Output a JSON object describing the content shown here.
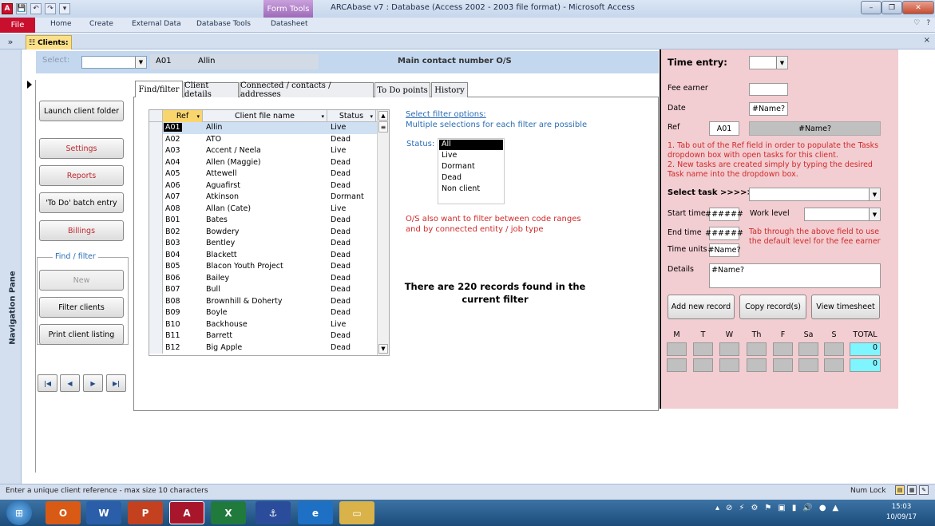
{
  "window": {
    "title": "ARCAbase v7 : Database (Access 2002 - 2003 file format)  -  Microsoft Access",
    "contextual_tab": "Form Tools",
    "file_tab": "File",
    "ribbon_tabs": [
      "Home",
      "Create",
      "External Data",
      "Database Tools",
      "Datasheet"
    ],
    "min_glyph": "–",
    "max_glyph": "❐",
    "close_glyph": "✕"
  },
  "document": {
    "tab_label": "Clients:",
    "navigation_pane_label": "Navigation Pane",
    "nav_collapse_glyph": "»",
    "close_glyph": "×"
  },
  "header": {
    "select_label": "Select:",
    "select_value": "",
    "ref": "A01",
    "name": "Allin",
    "main_contact": "Main contact number O/S"
  },
  "left_buttons": {
    "launch_client_folder": "Launch client folder",
    "settings": "Settings",
    "reports": "Reports",
    "todo_batch_entry": "'To Do' batch entry",
    "billings": "Billings",
    "find_filter_frame": "Find / filter",
    "new": "New",
    "filter_clients": "Filter clients",
    "print_client_listing": "Print client listing"
  },
  "record_nav": {
    "first": "|◀",
    "prev": "◀",
    "next": "▶",
    "last": "▶|"
  },
  "tabs": [
    "Find/filter",
    "Client details",
    "Connected / contacts / addresses",
    "To Do points",
    "History"
  ],
  "grid": {
    "columns": [
      "Ref",
      "Client file name",
      "Status"
    ],
    "rows": [
      [
        "A01",
        "Allin",
        "Live"
      ],
      [
        "A02",
        "ATO",
        "Dead"
      ],
      [
        "A03",
        "Accent / Neela",
        "Live"
      ],
      [
        "A04",
        "Allen (Maggie)",
        "Dead"
      ],
      [
        "A05",
        "Attewell",
        "Dead"
      ],
      [
        "A06",
        "Aguafirst",
        "Dead"
      ],
      [
        "A07",
        "Atkinson",
        "Dormant"
      ],
      [
        "A08",
        "Allan (Cate)",
        "Live"
      ],
      [
        "B01",
        "Bates",
        "Dead"
      ],
      [
        "B02",
        "Bowdery",
        "Dead"
      ],
      [
        "B03",
        "Bentley",
        "Dead"
      ],
      [
        "B04",
        "Blackett",
        "Dead"
      ],
      [
        "B05",
        "Blacon Youth Project",
        "Dead"
      ],
      [
        "B06",
        "Bailey",
        "Dead"
      ],
      [
        "B07",
        "Bull",
        "Dead"
      ],
      [
        "B08",
        "Brownhill & Doherty",
        "Dead"
      ],
      [
        "B09",
        "Boyle",
        "Dead"
      ],
      [
        "B10",
        "Backhouse",
        "Live"
      ],
      [
        "B11",
        "Barrett",
        "Dead"
      ],
      [
        "B12",
        "Big Apple",
        "Dead"
      ]
    ]
  },
  "filter": {
    "options_link": "Select filter options:",
    "options_sub": "Multiple selections for each filter are possible",
    "status_label": "Status:",
    "status_options": [
      "All",
      "Live",
      "Dormant",
      "Dead",
      "Non client"
    ],
    "note_line1": "O/S also want to filter between code ranges",
    "note_line2": "and by connected entity / job type",
    "records_found": "There are 220 records found in the current filter"
  },
  "time_entry": {
    "title": "Time entry:",
    "fee_earner_label": "Fee earner",
    "fee_earner_value": "",
    "date_label": "Date",
    "date_value": "#Name?",
    "ref_label": "Ref",
    "ref_value": "A01",
    "ref_name_value": "#Name?",
    "note_line1": "1. Tab out of the Ref field in order to populate the Tasks dropdown box with open tasks for this client.",
    "note_line2": "2. New tasks are created simply by typing the desired Task name into the dropdown box.",
    "select_task_label": "Select task >>>>>",
    "start_time_label": "Start time",
    "start_time_value": "######",
    "work_level_label": "Work level",
    "end_time_label": "End time",
    "end_time_value": "######",
    "work_level_note": "Tab through the above field to use the default level for the fee earner",
    "time_units_label": "Time units",
    "time_units_value": "#Name?",
    "details_label": "Details",
    "details_value": "#Name?",
    "add_new_record": "Add new record",
    "copy_records": "Copy record(s)",
    "view_timesheet": "View timesheet",
    "days": [
      "M",
      "T",
      "W",
      "Th",
      "F",
      "Sa",
      "S",
      "TOTAL"
    ],
    "totals": [
      "0",
      "0"
    ]
  },
  "statusbar": {
    "text": "Enter a unique client reference - max size 10 characters",
    "num_lock": "Num Lock"
  },
  "taskbar": {
    "time": "15:03",
    "date": "10/09/17"
  }
}
